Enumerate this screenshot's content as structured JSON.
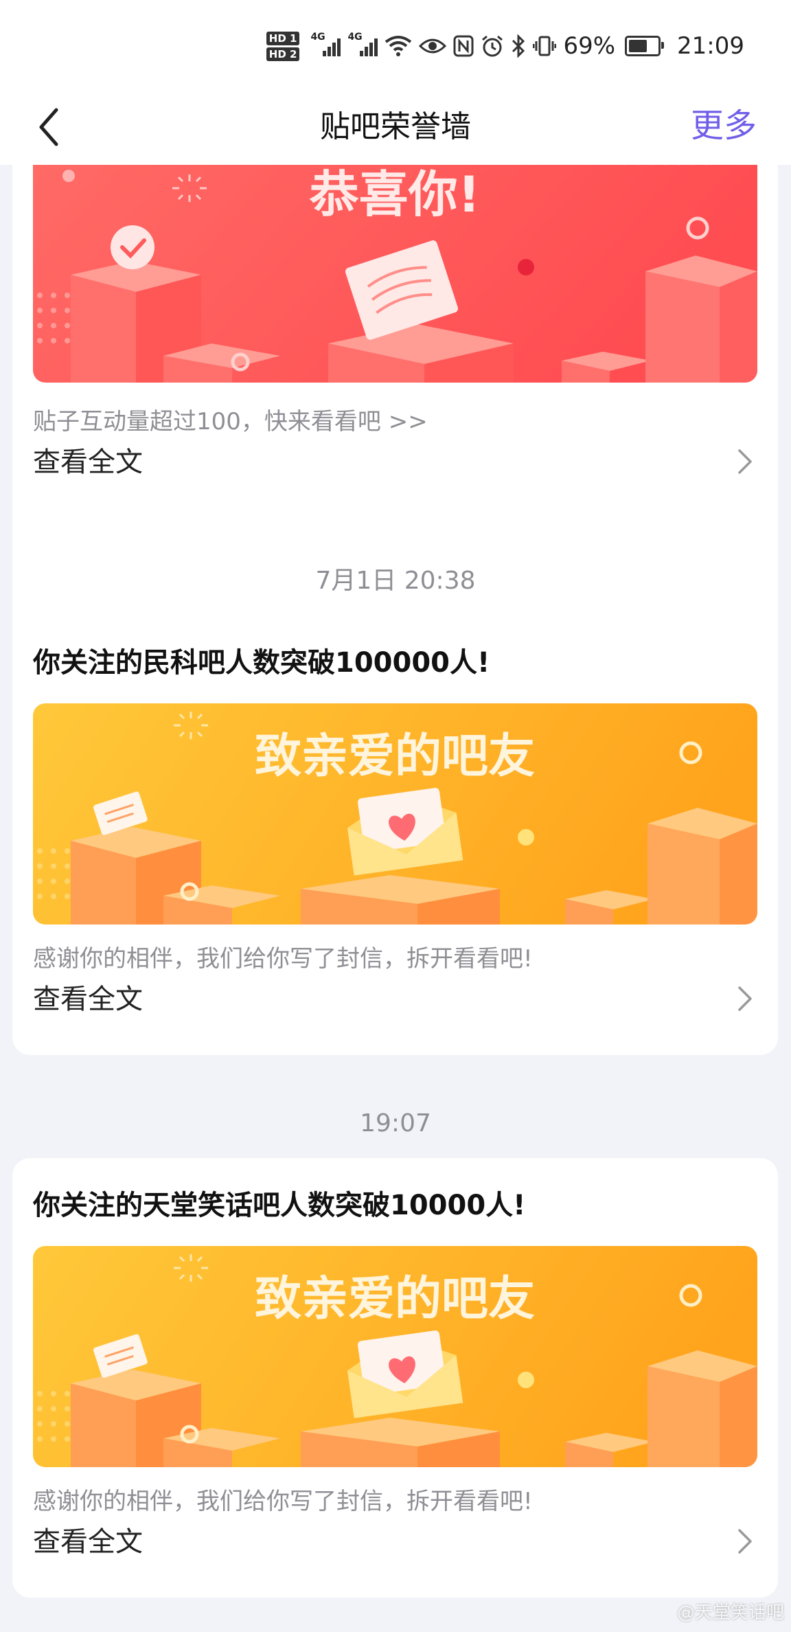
{
  "status_bar": {
    "hd1": "HD 1",
    "hd2": "HD 2",
    "net1": "4G",
    "net2": "4G",
    "battery": "69%",
    "time": "21:09",
    "icons": [
      "wifi-icon",
      "eye-icon",
      "nfc-icon",
      "alarm-icon",
      "bluetooth-icon",
      "vibrate-icon",
      "battery-icon"
    ]
  },
  "nav": {
    "title": "贴吧荣誉墙",
    "more": "更多",
    "back_icon": "chevron-left-icon"
  },
  "cards": [
    {
      "banner_text": "恭喜你!",
      "theme": "red",
      "desc": "贴子互动量超过100，快来看看吧 >>",
      "read_more": "查看全文"
    },
    {
      "timestamp": "7月1日 20:38",
      "title": "你关注的民科吧人数突破100000人!",
      "banner_text": "致亲爱的吧友",
      "theme": "orange",
      "desc": "感谢你的相伴，我们给你写了封信，拆开看看吧!",
      "read_more": "查看全文"
    },
    {
      "timestamp": "19:07",
      "title": "你关注的天堂笑话吧人数突破10000人!",
      "banner_text": "致亲爱的吧友",
      "theme": "orange",
      "desc": "感谢你的相伴，我们给你写了封信，拆开看看吧!",
      "read_more": "查看全文"
    }
  ],
  "watermark": "@天堂笑话吧",
  "colors": {
    "accent": "#6f5fe8",
    "red_banner": "#ff5a5f",
    "orange_banner": "#ffb420",
    "background": "#f2f3f8"
  }
}
